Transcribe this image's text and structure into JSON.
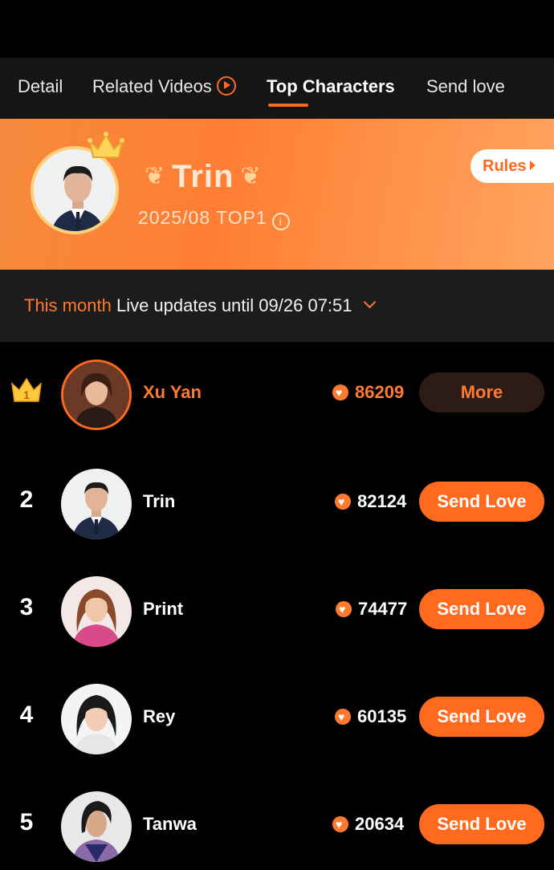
{
  "tabs": [
    {
      "label": "Detail"
    },
    {
      "label": "Related Videos"
    },
    {
      "label": "Top Characters"
    },
    {
      "label": "Send love"
    }
  ],
  "hero": {
    "name": "Trin",
    "rank_text": "2025/08 TOP1",
    "rules_label": "Rules"
  },
  "update_bar": {
    "month_label": "This month",
    "live_text": "Live updates until 09/26 07:51"
  },
  "ranking": [
    {
      "rank": "1",
      "name": "Xu Yan",
      "score": "86209",
      "action": "More"
    },
    {
      "rank": "2",
      "name": "Trin",
      "score": "82124",
      "action": "Send Love"
    },
    {
      "rank": "3",
      "name": "Print",
      "score": "74477",
      "action": "Send Love"
    },
    {
      "rank": "4",
      "name": "Rey",
      "score": "60135",
      "action": "Send Love"
    },
    {
      "rank": "5",
      "name": "Tanwa",
      "score": "20634",
      "action": "Send Love"
    }
  ],
  "colors": {
    "accent": "#ff6a1f",
    "hero_gradient_start": "#f58a3e",
    "hero_gradient_end": "#ffa45e",
    "background": "#000000"
  }
}
